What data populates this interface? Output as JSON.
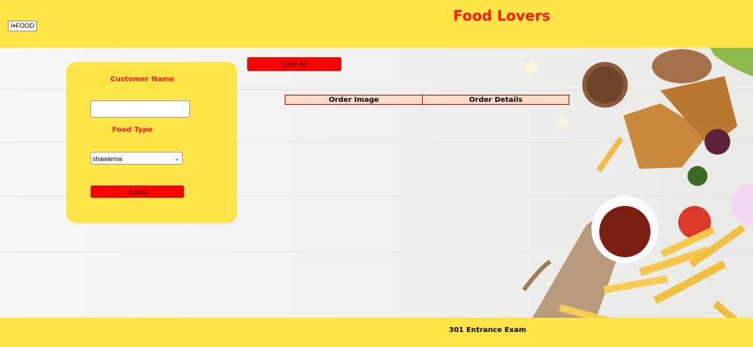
{
  "header": {
    "logo_text_left": "I",
    "logo_text_right": "FOOD",
    "title": "Food Lovers"
  },
  "form": {
    "customer_name_label": "Customer Name",
    "customer_name_value": "",
    "food_type_label": "Food Type",
    "food_type_selected": "shawarma",
    "submit_label": "submit"
  },
  "orders": {
    "clear_label": "Clear All",
    "columns": [
      "Order Image",
      "Order Details"
    ]
  },
  "footer": {
    "text": "301 Entrance Exam"
  },
  "colors": {
    "accent_yellow": "#ffe548",
    "title_red": "#ff1a1a",
    "button_red": "#ff0000",
    "table_header_bg": "#fbdcc8"
  },
  "icons": {
    "logo_heart": "heart-icon",
    "select_chevron": "chevron-down-icon"
  }
}
